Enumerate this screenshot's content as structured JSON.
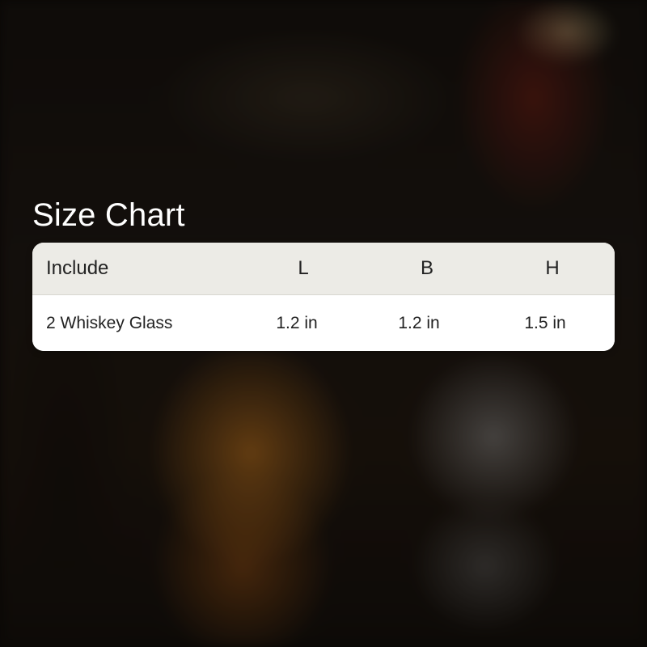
{
  "title": "Size Chart",
  "table": {
    "headers": {
      "include": "Include",
      "l": "L",
      "b": "B",
      "h": "H"
    },
    "rows": [
      {
        "include": "2 Whiskey Glass",
        "l": "1.2 in",
        "b": "1.2 in",
        "h": "1.5 in"
      }
    ]
  },
  "colors": {
    "title_text": "#ffffff",
    "header_bg": "#ecebe6",
    "row_bg": "#ffffff",
    "cell_text": "#222222"
  }
}
